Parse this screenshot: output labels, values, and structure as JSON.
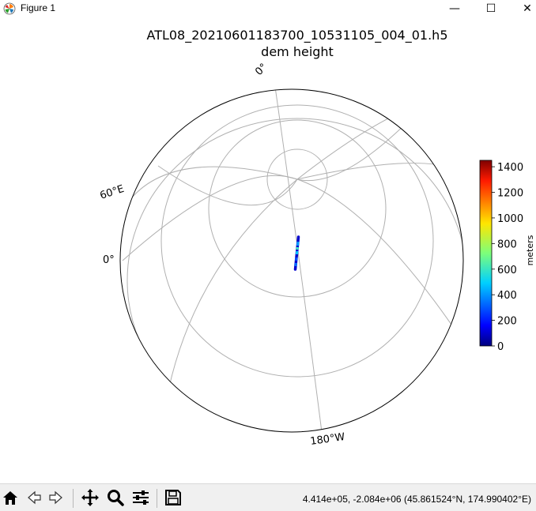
{
  "window": {
    "title": "Figure 1",
    "minimize_symbol": "—",
    "maximize_symbol": "☐",
    "close_symbol": "✕"
  },
  "figure": {
    "title_line1": "ATL08_20210601183700_10531105_004_01.h5",
    "title_line2": "dem height",
    "grid_labels": {
      "top": "0°",
      "left_upper": "60°E",
      "left_lower": "0°",
      "bottom": "180°W"
    }
  },
  "colorbar": {
    "label": "meters",
    "ticks": [
      "1400",
      "1200",
      "1000",
      "800",
      "600",
      "400",
      "200",
      "0"
    ],
    "colormap": "jet",
    "range": [
      0,
      1450
    ]
  },
  "toolbar": {
    "icons": [
      "home-icon",
      "back-icon",
      "forward-icon",
      "pan-icon",
      "zoom-icon",
      "configure-subplots-icon",
      "save-icon"
    ],
    "coords_text": "4.414e+05, -2.084e+06 (45.861524°N, 174.990402°E)"
  }
}
